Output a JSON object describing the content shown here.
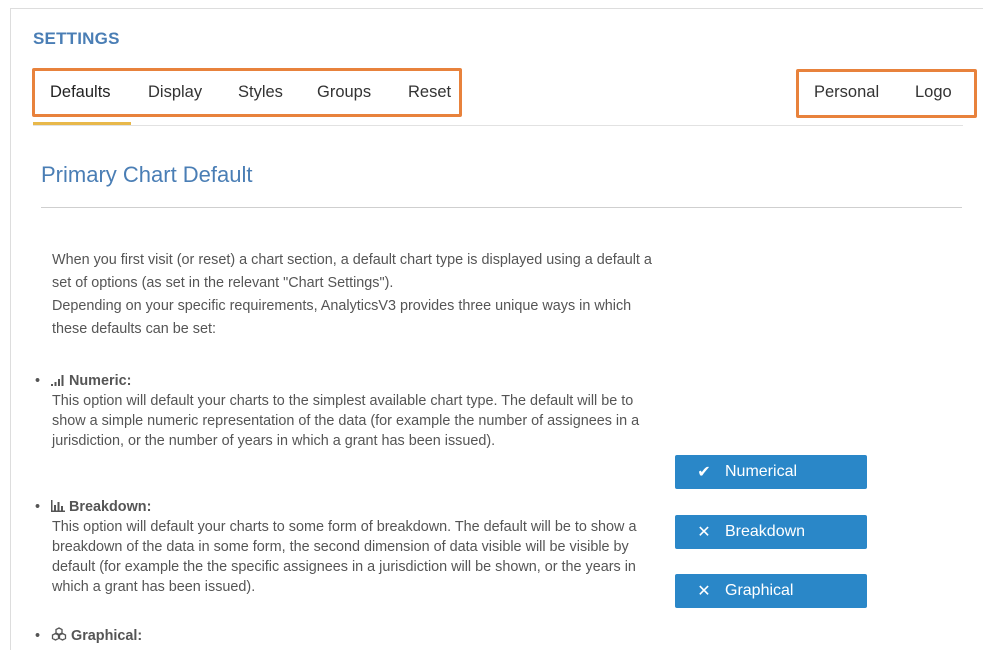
{
  "header": {
    "title": "SETTINGS"
  },
  "tabs_left": [
    {
      "label": "Defaults",
      "active": true
    },
    {
      "label": "Display"
    },
    {
      "label": "Styles"
    },
    {
      "label": "Groups"
    },
    {
      "label": "Reset"
    }
  ],
  "tabs_right": [
    {
      "label": "Personal"
    },
    {
      "label": "Logo"
    }
  ],
  "section": {
    "title": "Primary Chart Default"
  },
  "intro": {
    "p1": "When you first visit (or reset) a chart section, a default chart type is displayed using a default a set of options (as set in the relevant \"Chart Settings\").",
    "p2": "Depending on your specific requirements, AnalyticsV3 provides three unique ways in which these defaults can be set:"
  },
  "options": [
    {
      "title": "Numeric:",
      "icon": "signal-bars-icon",
      "desc": "This option will default your charts to the simplest available chart type. The default will be to show a simple numeric representation of the data (for example the number of assignees in a jurisdiction, or the number of years in which a grant has been issued)."
    },
    {
      "title": "Breakdown:",
      "icon": "bar-chart-icon",
      "desc": "This option will default your charts to some form of breakdown. The default will be to show a breakdown of the data in some form, the second dimension of data visible will be visible by default (for example the the specific assignees in a jurisdiction will be shown, or the years in which a grant has been issued)."
    },
    {
      "title": "Graphical:",
      "icon": "cubes-icon",
      "desc": ""
    }
  ],
  "buttons": [
    {
      "label": "Numerical",
      "mark": "✔",
      "selected": true
    },
    {
      "label": "Breakdown",
      "mark": "✕",
      "selected": false
    },
    {
      "label": "Graphical",
      "mark": "✕",
      "selected": false
    }
  ],
  "colors": {
    "accent": "#4a7eb5",
    "button": "#2a87c8",
    "tab_underline": "#e8b84a",
    "highlight": "#e8823c"
  }
}
